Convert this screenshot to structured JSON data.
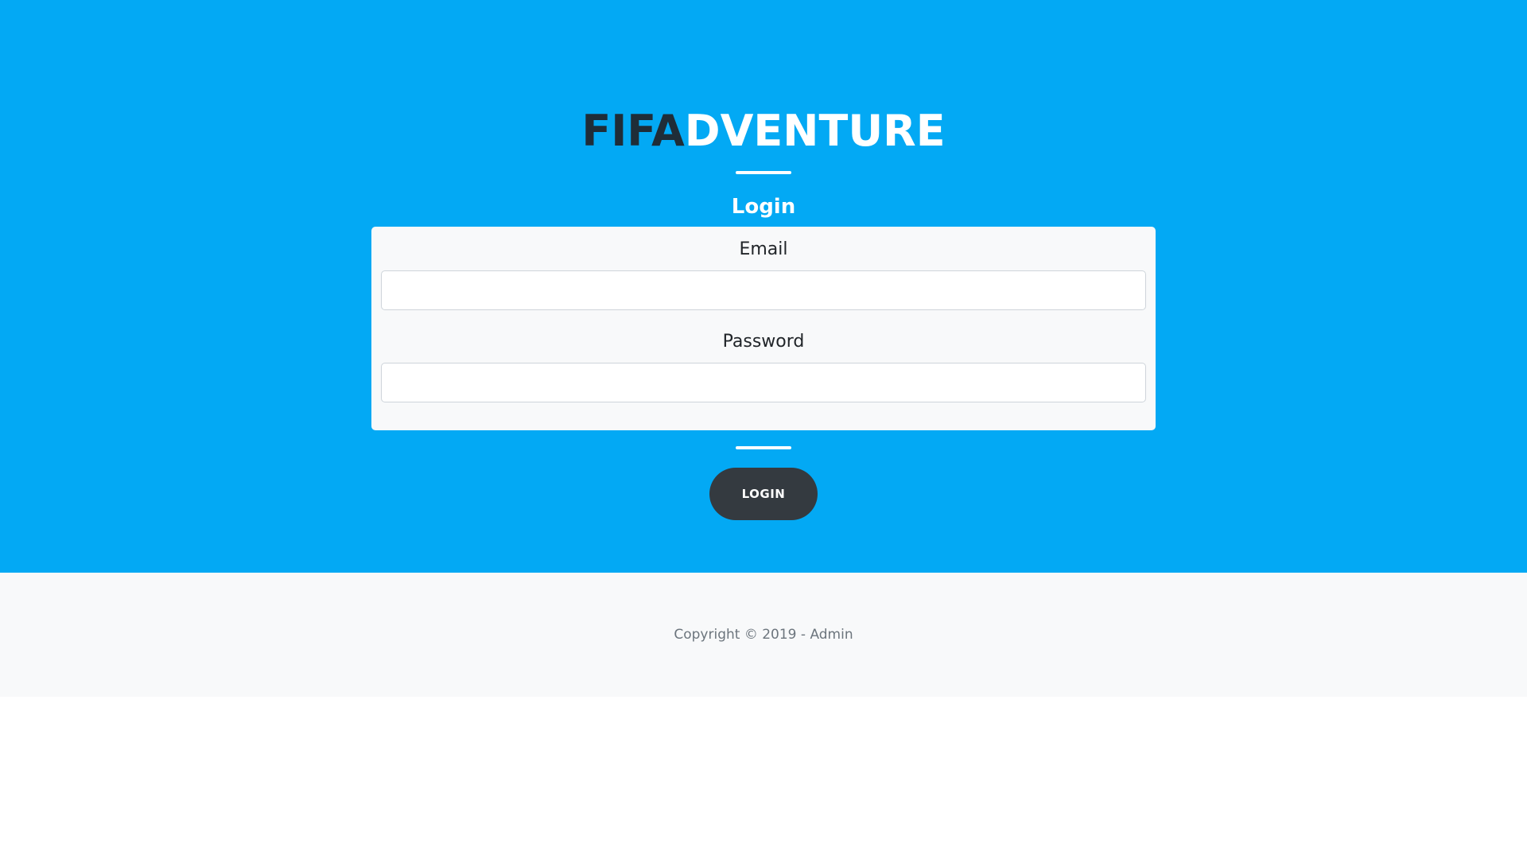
{
  "brand": {
    "part1": "FIFA",
    "part2": "DVENTURE",
    "color_dark": "#1f2d38",
    "color_light": "#ffffff"
  },
  "login": {
    "title": "Login",
    "email_label": "Email",
    "email_value": "",
    "password_label": "Password",
    "password_value": "",
    "button_label": "LOGIN"
  },
  "footer": {
    "copyright": "Copyright © 2019 - Admin"
  },
  "colors": {
    "hero_background": "#03a9f4",
    "button_background": "#343a40",
    "footer_background": "#f8f9fa"
  }
}
